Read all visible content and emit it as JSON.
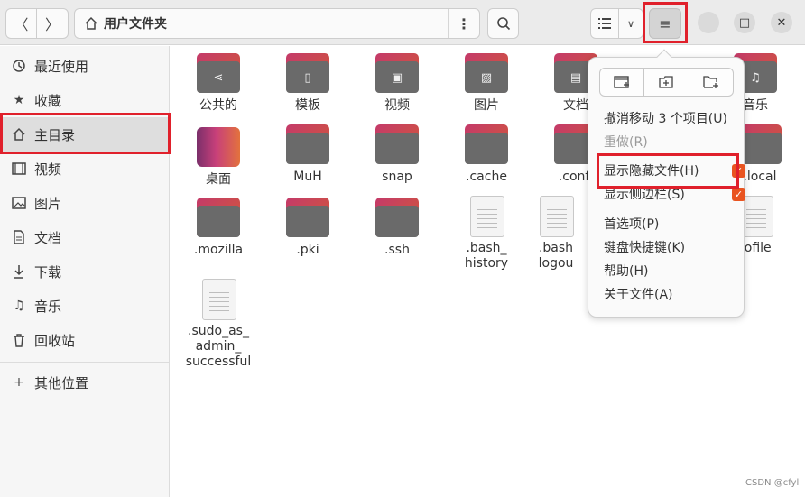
{
  "header": {
    "location_title": "用户文件夹",
    "more_label": "⋮",
    "back_glyph": "〈",
    "forward_glyph": "〉",
    "view_arrow_glyph": "∨",
    "menu_glyph": "≡",
    "min_glyph": "—",
    "max_glyph": "□",
    "close_glyph": "✕"
  },
  "sidebar": {
    "items": [
      {
        "label": "最近使用",
        "icon": "clock-icon"
      },
      {
        "label": "收藏",
        "icon": "star-icon"
      },
      {
        "label": "主目录",
        "icon": "home-icon"
      },
      {
        "label": "视频",
        "icon": "film-icon"
      },
      {
        "label": "图片",
        "icon": "image-icon"
      },
      {
        "label": "文档",
        "icon": "document-icon"
      },
      {
        "label": "下载",
        "icon": "download-icon"
      },
      {
        "label": "音乐",
        "icon": "music-icon"
      },
      {
        "label": "回收站",
        "icon": "trash-icon"
      },
      {
        "label": "其他位置",
        "icon": "plus-icon"
      }
    ],
    "active_item": "主目录"
  },
  "files": [
    {
      "name": "公共的",
      "type": "folder",
      "glyph": "share"
    },
    {
      "name": "模板",
      "type": "folder",
      "glyph": "template"
    },
    {
      "name": "视频",
      "type": "folder",
      "glyph": "film"
    },
    {
      "name": "图片",
      "type": "folder",
      "glyph": "image"
    },
    {
      "name": "文档",
      "type": "folder",
      "glyph": "document"
    },
    {
      "name": "音乐",
      "type": "folder",
      "glyph": "music"
    },
    {
      "name": "桌面",
      "type": "desktop-folder"
    },
    {
      "name": "MuH",
      "type": "folder"
    },
    {
      "name": "snap",
      "type": "folder"
    },
    {
      "name": ".cache",
      "type": "folder"
    },
    {
      "name": ".confi",
      "type": "folder"
    },
    {
      "name": ".local",
      "type": "folder"
    },
    {
      "name": ".mozilla",
      "type": "folder"
    },
    {
      "name": ".pki",
      "type": "folder"
    },
    {
      "name": ".ssh",
      "type": "folder"
    },
    {
      "name": ".bash_\nhistory",
      "type": "text-file"
    },
    {
      "name": ".bash\nlogou",
      "type": "text-file"
    },
    {
      "name": "rofile",
      "type": "text-file"
    },
    {
      "name": ".sudo_as_\nadmin_\nsuccessful",
      "type": "text-file"
    }
  ],
  "menu": {
    "toolbar_icons": [
      "new-window-icon",
      "new-tab-icon",
      "new-folder-icon"
    ],
    "items": [
      {
        "label": "撤消移动 3 个项目(U)",
        "enabled": true
      },
      {
        "label": "重做(R)",
        "enabled": false
      },
      {
        "label": "显示隐藏文件(H)",
        "enabled": true,
        "checked": true
      },
      {
        "label": "显示侧边栏(S)",
        "enabled": true,
        "checked": true
      },
      {
        "label": "首选项(P)",
        "enabled": true
      },
      {
        "label": "键盘快捷键(K)",
        "enabled": true
      },
      {
        "label": "帮助(H)",
        "enabled": true
      },
      {
        "label": "关于文件(A)",
        "enabled": true
      }
    ],
    "check_glyph": "✓"
  },
  "colors": {
    "accent": "#e95420",
    "highlight_red": "#e0202b",
    "folder_body": "#6a6a6a"
  },
  "watermark": "CSDN @cfyl"
}
